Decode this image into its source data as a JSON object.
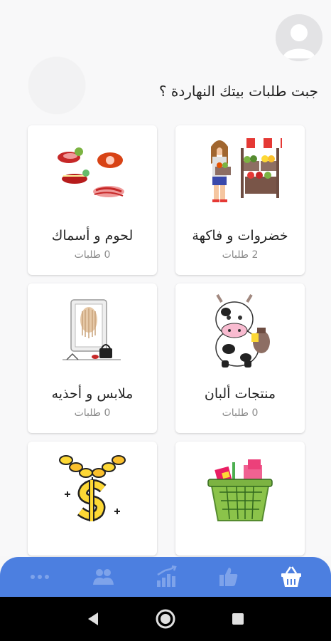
{
  "header": {
    "avatar_icon": "user-avatar-icon",
    "headline": "جبت طلبات بيتك النهاردة ؟"
  },
  "categories": [
    {
      "title": "خضروات و فاكهة",
      "count": "2 طلبات",
      "icon": "vegetable-stand-icon"
    },
    {
      "title": "لحوم و أسماك",
      "count": "0 طلبات",
      "icon": "meat-fish-icon"
    },
    {
      "title": "منتجات ألبان",
      "count": "0 طلبات",
      "icon": "dairy-cow-icon"
    },
    {
      "title": "ملابس و أحذيه",
      "count": "0 طلبات",
      "icon": "clothes-shoes-icon"
    },
    {
      "title": "",
      "count": "",
      "icon": "grocery-basket-icon"
    },
    {
      "title": "",
      "count": "",
      "icon": "gold-chain-dollar-icon"
    }
  ],
  "bottom_nav": {
    "color": "#4c7fe0",
    "items": [
      "basket-icon",
      "thumbs-up-icon",
      "stats-icon",
      "people-icon",
      "more-icon"
    ],
    "active": "basket-icon"
  },
  "system_nav": [
    "back-icon",
    "home-icon",
    "recents-icon"
  ]
}
